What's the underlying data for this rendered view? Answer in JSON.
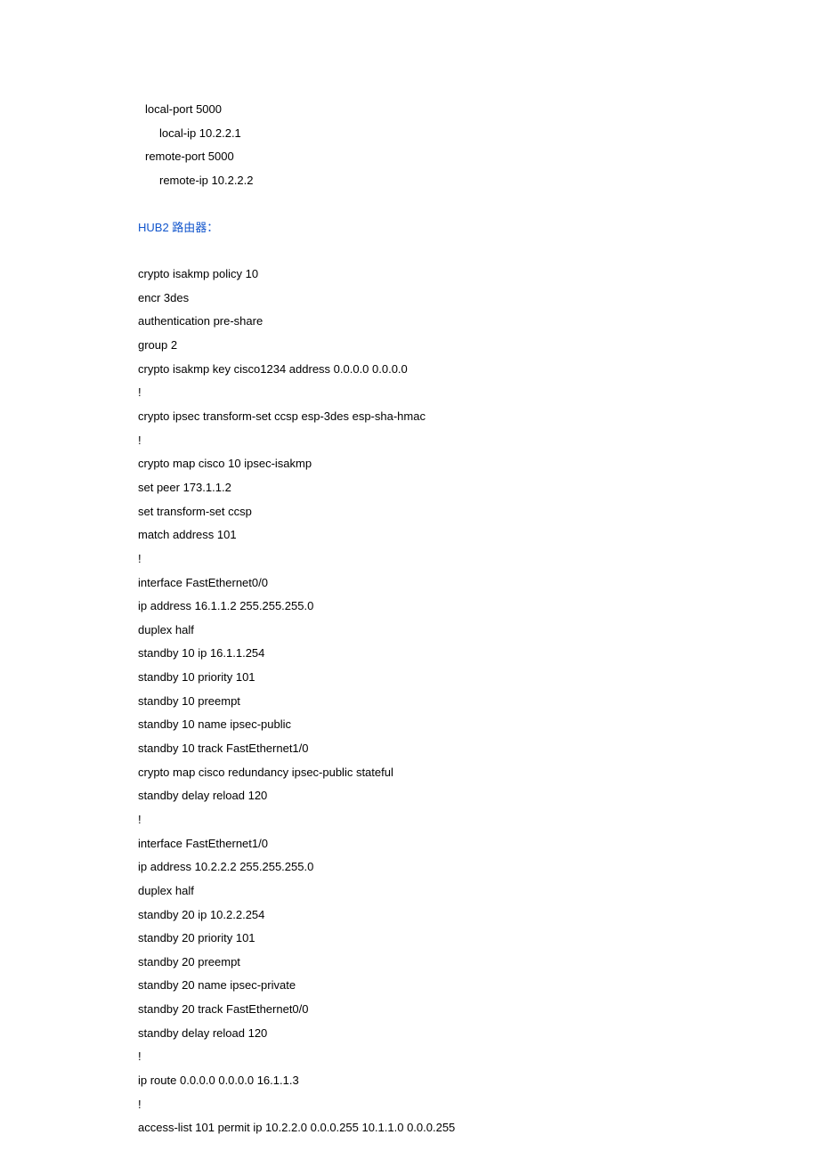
{
  "block1": {
    "l1": "local-port 5000",
    "l2": "local-ip 10.2.2.1",
    "l3": "remote-port 5000",
    "l4": "remote-ip 10.2.2.2"
  },
  "heading": "HUB2 路由器：",
  "config": {
    "l1": "crypto isakmp policy 10",
    "l2": "encr 3des",
    "l3": "authentication pre-share",
    "l4": "group 2",
    "l5": "crypto isakmp key cisco1234 address 0.0.0.0 0.0.0.0",
    "l6": "!",
    "l7": "crypto ipsec transform-set ccsp esp-3des esp-sha-hmac",
    "l8": "!",
    "l9": "crypto map cisco 10 ipsec-isakmp",
    "l10": "set peer 173.1.1.2",
    "l11": "set transform-set ccsp",
    "l12": "match address 101",
    "l13": "!",
    "l14": "interface FastEthernet0/0",
    "l15": "ip address 16.1.1.2 255.255.255.0",
    "l16": "duplex half",
    "l17": "standby 10 ip 16.1.1.254",
    "l18": "standby 10 priority 101",
    "l19": "standby 10 preempt",
    "l20": "standby 10 name ipsec-public",
    "l21": "standby 10 track FastEthernet1/0",
    "l22": "crypto map cisco redundancy ipsec-public stateful",
    "l23": "standby delay reload 120",
    "l24": "!",
    "l25": "interface FastEthernet1/0",
    "l26": "ip address 10.2.2.2 255.255.255.0",
    "l27": "duplex half",
    "l28": "standby 20 ip 10.2.2.254",
    "l29": "standby 20 priority 101",
    "l30": "standby 20 preempt",
    "l31": "standby 20 name ipsec-private",
    "l32": "standby 20 track FastEthernet0/0",
    "l33": "standby delay reload 120",
    "l34": "!",
    "l35": "ip route 0.0.0.0 0.0.0.0 16.1.1.3",
    "l36": "!",
    "l37": "access-list 101 permit ip 10.2.2.0 0.0.0.255 10.1.1.0 0.0.0.255"
  }
}
